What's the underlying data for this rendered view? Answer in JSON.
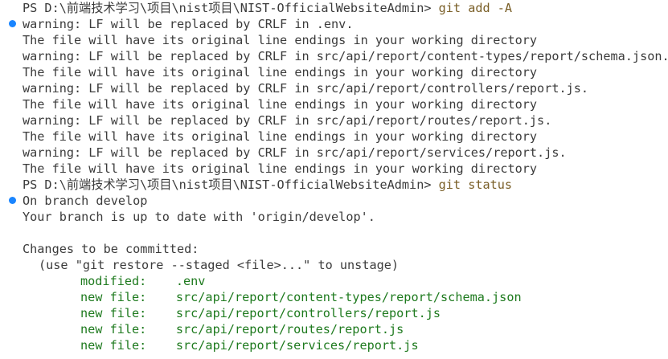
{
  "terminal": {
    "block1": {
      "prompt": "PS D:\\前端技术学习\\项目\\nist项目\\NIST-OfficialWebsiteAdmin> ",
      "command": "git add -A",
      "output": [
        "warning: LF will be replaced by CRLF in .env.",
        "The file will have its original line endings in your working directory",
        "warning: LF will be replaced by CRLF in src/api/report/content-types/report/schema.json.",
        "The file will have its original line endings in your working directory",
        "warning: LF will be replaced by CRLF in src/api/report/controllers/report.js.",
        "The file will have its original line endings in your working directory",
        "warning: LF will be replaced by CRLF in src/api/report/routes/report.js.",
        "The file will have its original line endings in your working directory",
        "warning: LF will be replaced by CRLF in src/api/report/services/report.js.",
        "The file will have its original line endings in your working directory"
      ]
    },
    "block2": {
      "prompt": "PS D:\\前端技术学习\\项目\\nist项目\\NIST-OfficialWebsiteAdmin> ",
      "command": "git status",
      "branch_line": "On branch develop",
      "up_to_date_line": "Your branch is up to date with 'origin/develop'.",
      "changes_header": "Changes to be committed:",
      "hint": "(use \"git restore --staged <file>...\" to unstage)",
      "files": [
        {
          "status": "modified:",
          "path": ".env"
        },
        {
          "status": "new file:",
          "path": "src/api/report/content-types/report/schema.json"
        },
        {
          "status": "new file:",
          "path": "src/api/report/controllers/report.js"
        },
        {
          "status": "new file:",
          "path": "src/api/report/routes/report.js"
        },
        {
          "status": "new file:",
          "path": "src/api/report/services/report.js"
        }
      ]
    }
  },
  "colors": {
    "background": "#ffffff",
    "text": "#3b3b3b",
    "command": "#795e26",
    "staged": "#1e7a1e",
    "gutter_dot": "#1a85ff"
  },
  "icons": {
    "gutter": "command-decoration-dot-icon"
  }
}
